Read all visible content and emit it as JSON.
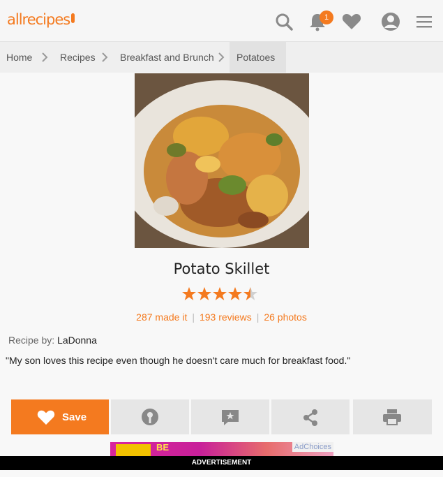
{
  "header": {
    "logo": "allrecipes",
    "notification_count": "1"
  },
  "breadcrumbs": [
    "Home",
    "Recipes",
    "Breakfast and Brunch",
    "Potatoes"
  ],
  "recipe": {
    "title": "Potato Skillet",
    "rating": 4.5,
    "made_it": "287 made it",
    "reviews": "193 reviews",
    "photos": "26 photos",
    "by_label": "Recipe by:",
    "author": "LaDonna",
    "description": "\"My son loves this recipe even though he doesn't care much for breakfast food.\""
  },
  "actions": {
    "save_label": "Save"
  },
  "ad": {
    "choices_label": "AdChoices",
    "banner_label": "ADVERTISEMENT"
  },
  "colors": {
    "accent": "#f47a1f",
    "icon_gray": "#8a8a8a"
  }
}
